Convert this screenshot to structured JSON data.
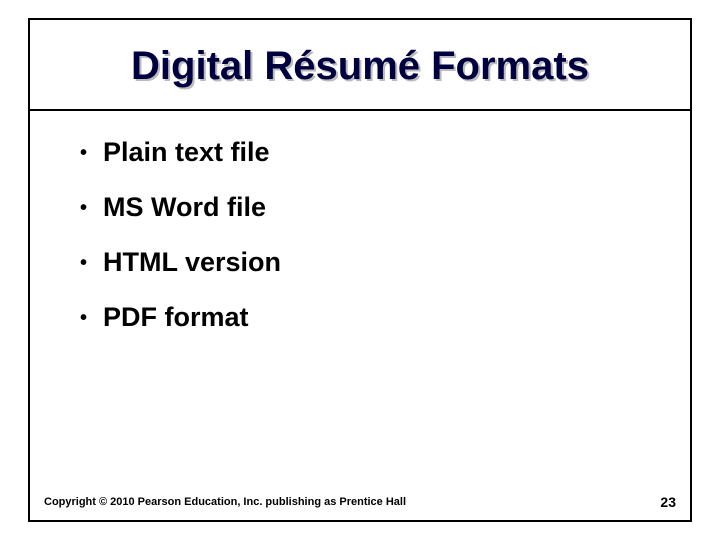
{
  "title": "Digital Résumé Formats",
  "bullets": [
    "Plain text file",
    "MS Word file",
    "HTML version",
    "PDF format"
  ],
  "copyright": "Copyright © 2010 Pearson Education, Inc. publishing as Prentice Hall",
  "page_number": "23"
}
